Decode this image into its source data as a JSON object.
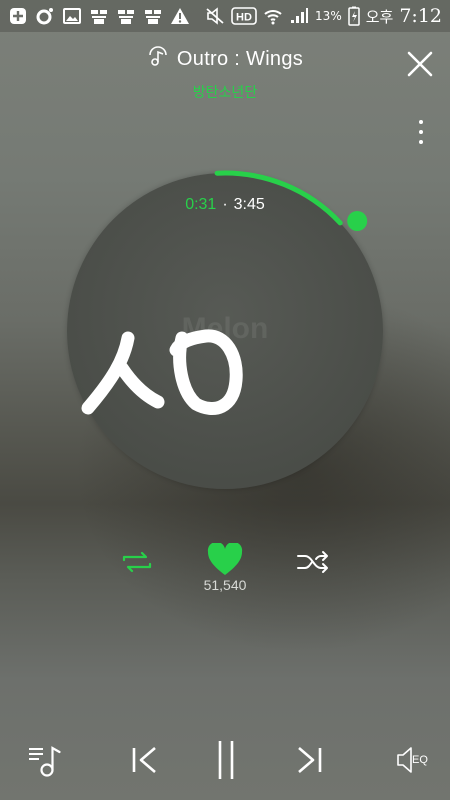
{
  "status_bar": {
    "icons": [
      "plus-box-icon",
      "circle-o-icon",
      "image-icon",
      "app-icon",
      "app-icon",
      "app-icon",
      "warning-icon",
      "mute-icon",
      "hd-icon",
      "wifi-icon",
      "signal-icon",
      "battery-charging-icon"
    ],
    "battery_percent": "13%",
    "am_pm": "오후",
    "time": "7:12"
  },
  "header": {
    "title_icon": "music-note-icon",
    "song_title": "Outro : Wings",
    "artist": "방탄소년단"
  },
  "player": {
    "elapsed": "0:31",
    "separator": "·",
    "total": "3:45",
    "progress_fraction": 0.138,
    "watermark": "Melon",
    "accent_color": "#28d04a"
  },
  "controls": {
    "like_count": "51,540",
    "repeat_icon": "repeat-icon",
    "like_icon": "heart-icon",
    "shuffle_icon": "shuffle-icon"
  },
  "bottom_bar": {
    "playlist_icon": "playlist-icon",
    "prev_icon": "previous-icon",
    "pause_icon": "pause-icon",
    "next_icon": "next-icon",
    "eq_label": "EQ"
  }
}
